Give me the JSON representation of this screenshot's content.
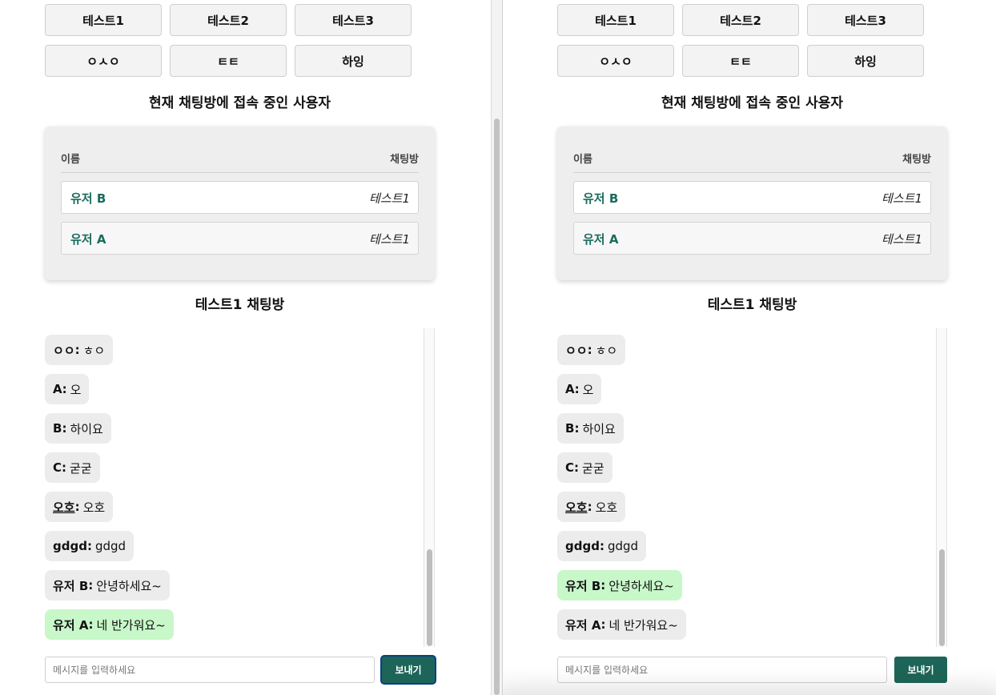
{
  "room_buttons": [
    "테스트1",
    "테스트2",
    "테스트3",
    "ㅇㅅㅇ",
    "ㅌㅌ",
    "하잉"
  ],
  "users_section_title": "현재 채팅방에 접속 중인 사용자",
  "users_table": {
    "header_name": "이름",
    "header_room": "채팅방",
    "rows": [
      {
        "name": "유저 B",
        "room": "테스트1"
      },
      {
        "name": "유저 A",
        "room": "테스트1"
      }
    ]
  },
  "chat_title": "테스트1 채팅방",
  "messages": [
    {
      "sender": "ㅇㅇ",
      "text": "ㅎㅇ"
    },
    {
      "sender": "A",
      "text": "오"
    },
    {
      "sender": "B",
      "text": "하이요"
    },
    {
      "sender": "C",
      "text": "굳굳"
    },
    {
      "sender": "오호",
      "text": "오호"
    },
    {
      "sender": "gdgd",
      "text": "gdgd"
    },
    {
      "sender": "유저 B",
      "text": "안녕하세요~"
    },
    {
      "sender": "유저 A",
      "text": "네 반가워요~"
    }
  ],
  "composer": {
    "placeholder": "메시지를 입력하세요",
    "send_label": "보내기"
  },
  "panes": [
    {
      "id": "left",
      "current_user": "유저 A",
      "send_focused": true
    },
    {
      "id": "right",
      "current_user": "유저 B",
      "send_focused": false
    }
  ],
  "colors": {
    "own_message_bg": "#c8f7c9",
    "other_message_bg": "#ececec",
    "user_name": "#1b6b5c",
    "send_button": "#1d6558"
  }
}
